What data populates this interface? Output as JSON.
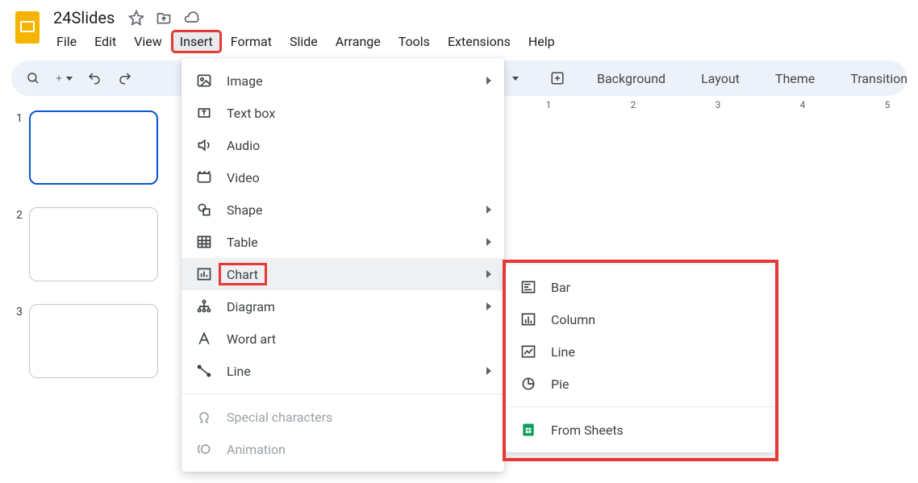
{
  "doc": {
    "title": "24Slides"
  },
  "menubar": {
    "file": "File",
    "edit": "Edit",
    "view": "View",
    "insert": "Insert",
    "format": "Format",
    "slide": "Slide",
    "arrange": "Arrange",
    "tools": "Tools",
    "extensions": "Extensions",
    "help": "Help"
  },
  "toolbar": {
    "background": "Background",
    "layout": "Layout",
    "theme": "Theme",
    "transition": "Transition"
  },
  "thumbnails": [
    {
      "number": "1",
      "selected": true
    },
    {
      "number": "2",
      "selected": false
    },
    {
      "number": "3",
      "selected": false
    }
  ],
  "ruler": {
    "ticks": [
      "1",
      "2",
      "3",
      "4",
      "5"
    ]
  },
  "insertMenu": {
    "image": "Image",
    "textbox": "Text box",
    "audio": "Audio",
    "video": "Video",
    "shape": "Shape",
    "table": "Table",
    "chart": "Chart",
    "diagram": "Diagram",
    "wordart": "Word art",
    "line": "Line",
    "specialchars": "Special characters",
    "animation": "Animation"
  },
  "chartSubmenu": {
    "bar": "Bar",
    "column": "Column",
    "line": "Line",
    "pie": "Pie",
    "fromsheets": "From Sheets"
  }
}
